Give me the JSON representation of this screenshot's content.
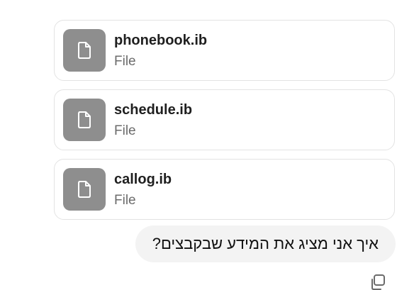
{
  "attachments": [
    {
      "name": "phonebook.ib",
      "type": "File",
      "icon": "file-icon"
    },
    {
      "name": "schedule.ib",
      "type": "File",
      "icon": "file-icon"
    },
    {
      "name": "callog.ib",
      "type": "File",
      "icon": "file-icon"
    }
  ],
  "message": {
    "text": "איך אני מציג את המידע שבקבצים?",
    "direction": "rtl"
  },
  "actions": {
    "copy_icon": "copy-icon"
  },
  "colors": {
    "icon_tile": "#8e8e8e",
    "bubble": "#f3f3f3",
    "card_border": "#e3e3e3"
  }
}
